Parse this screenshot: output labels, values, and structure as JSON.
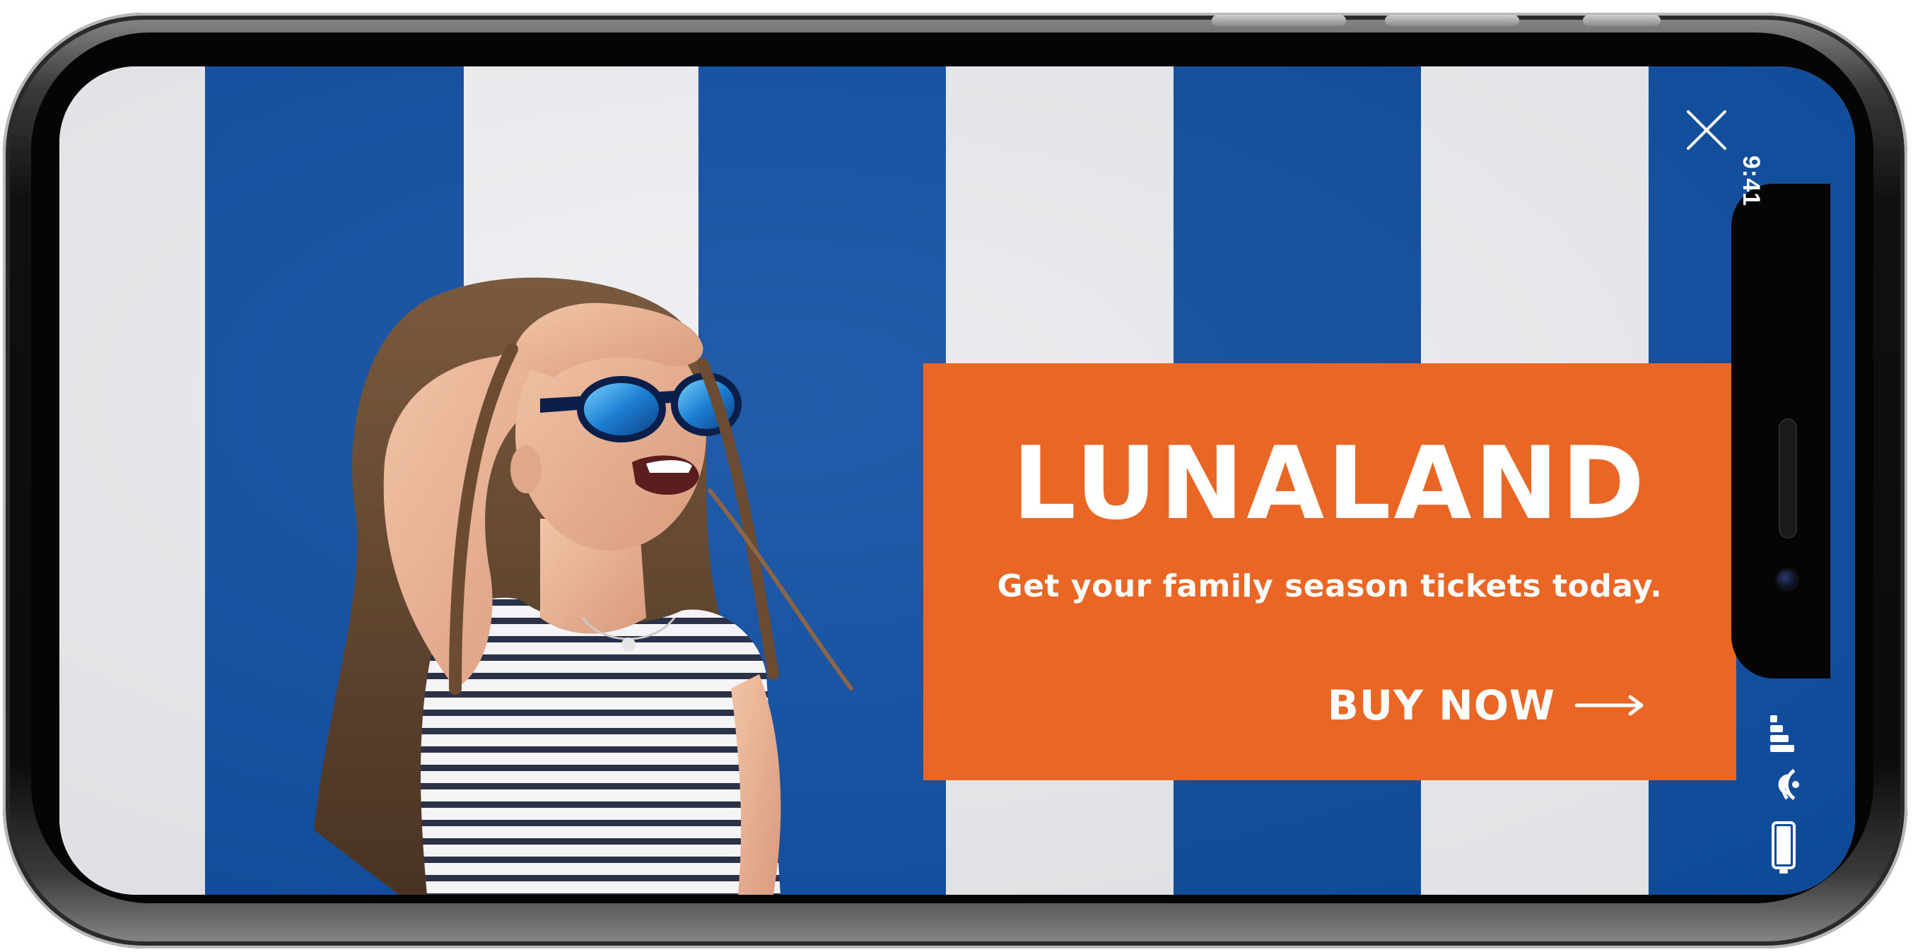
{
  "ad": {
    "brand": "LUNALAND",
    "tagline": "Get your family season tickets today.",
    "cta_label": "BUY NOW",
    "cta_icon": "arrow-right-icon",
    "panel_color": "#ea6624"
  },
  "status_bar": {
    "time": "9:41",
    "icons": [
      "signal-icon",
      "wifi-icon",
      "battery-icon"
    ]
  },
  "controls": {
    "close_icon": "close-icon"
  },
  "background": {
    "stripe_colors": [
      "#0f4da0",
      "#eceef1"
    ]
  }
}
